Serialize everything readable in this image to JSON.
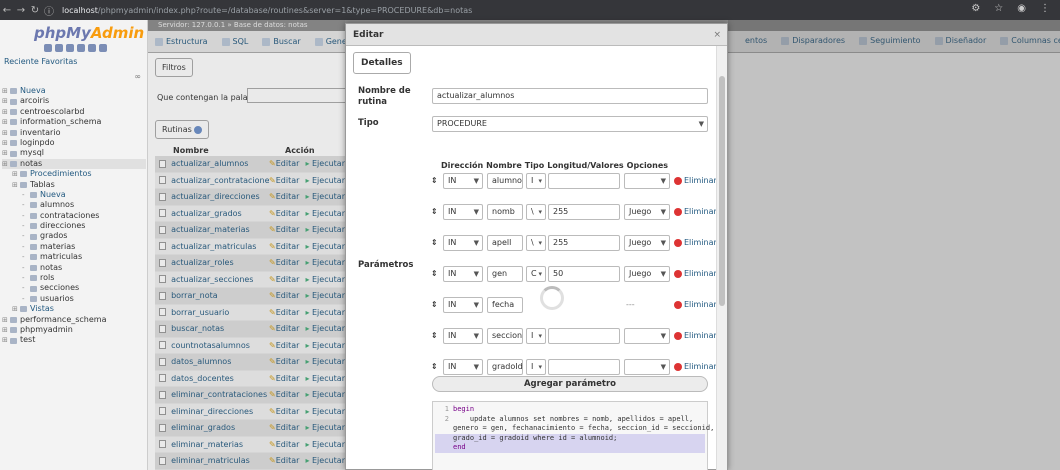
{
  "browser": {
    "url_host": "localhost",
    "url_path": "/phpmyadmin/index.php?route=/database/routines&server=1&type=PROCEDURE&db=notas"
  },
  "left_panel": {
    "logo_main": "phpMy",
    "logo_accent": "Admin",
    "recent_favorites": "Reciente  Favoritas",
    "tree": [
      {
        "label": "Nueva",
        "level": 0,
        "link": true
      },
      {
        "label": "arcoiris",
        "level": 0
      },
      {
        "label": "centroescolarbd",
        "level": 0
      },
      {
        "label": "information_schema",
        "level": 0
      },
      {
        "label": "inventario",
        "level": 0
      },
      {
        "label": "loginpdo",
        "level": 0
      },
      {
        "label": "mysql",
        "level": 0
      },
      {
        "label": "notas",
        "level": 0,
        "selected": true
      },
      {
        "label": "Procedimientos",
        "level": 1,
        "link": true
      },
      {
        "label": "Tablas",
        "level": 1
      },
      {
        "label": "Nueva",
        "level": 2,
        "link": true
      },
      {
        "label": "alumnos",
        "level": 2
      },
      {
        "label": "contrataciones",
        "level": 2
      },
      {
        "label": "direcciones",
        "level": 2
      },
      {
        "label": "grados",
        "level": 2
      },
      {
        "label": "materias",
        "level": 2
      },
      {
        "label": "matriculas",
        "level": 2
      },
      {
        "label": "notas",
        "level": 2
      },
      {
        "label": "rols",
        "level": 2
      },
      {
        "label": "secciones",
        "level": 2
      },
      {
        "label": "usuarios",
        "level": 2
      },
      {
        "label": "Vistas",
        "level": 1,
        "link": true
      },
      {
        "label": "performance_schema",
        "level": 0
      },
      {
        "label": "phpmyadmin",
        "level": 0
      },
      {
        "label": "test",
        "level": 0
      }
    ]
  },
  "topbar": {
    "breadcrumb": "Servidor: 127.0.0.1 » Base de datos: notas"
  },
  "tabs": {
    "left": [
      "Estructura",
      "SQL",
      "Buscar",
      "Gener"
    ],
    "right": [
      "entos",
      "Disparadores",
      "Seguimiento",
      "Diseñador",
      "Columnas centrales"
    ]
  },
  "filters": {
    "legend": "Filtros",
    "label": "Que contengan la palabra:"
  },
  "routines": {
    "legend": "Rutinas",
    "header_name": "Nombre",
    "header_action": "Acción",
    "edit_label": "Editar",
    "exec_label": "Ejecutar",
    "items": [
      "actualizar_alumnos",
      "actualizar_contrataciones",
      "actualizar_direcciones",
      "actualizar_grados",
      "actualizar_materias",
      "actualizar_matriculas",
      "actualizar_roles",
      "actualizar_secciones",
      "borrar_nota",
      "borrar_usuario",
      "buscar_notas",
      "countnotasalumnos",
      "datos_alumnos",
      "datos_docentes",
      "eliminar_contrataciones",
      "eliminar_direcciones",
      "eliminar_grados",
      "eliminar_materias",
      "eliminar_matriculas"
    ]
  },
  "dialog": {
    "title": "Editar",
    "close": "×",
    "details_legend": "Detalles",
    "name_label": "Nombre de rutina",
    "name_value": "actualizar_alumnos",
    "type_label": "Tipo",
    "type_value": "PROCEDURE",
    "params_label": "Parámetros",
    "param_headers": [
      "Dirección",
      "Nombre",
      "Tipo",
      "Longitud/Valores",
      "Opciones"
    ],
    "delete_label": "Eliminar",
    "params": [
      {
        "dir": "IN",
        "name": "alumnoi",
        "type": "I",
        "len": "",
        "opt": ""
      },
      {
        "dir": "IN",
        "name": "nomb",
        "type": "\\",
        "len": "255",
        "opt": "Juego"
      },
      {
        "dir": "IN",
        "name": "apell",
        "type": "\\",
        "len": "255",
        "opt": "Juego"
      },
      {
        "dir": "IN",
        "name": "gen",
        "type": "C",
        "len": "50",
        "opt": "Juego"
      },
      {
        "dir": "IN",
        "name": "fecha",
        "type": "",
        "len": "",
        "opt": "---"
      },
      {
        "dir": "IN",
        "name": "seccioni",
        "type": "I",
        "len": "",
        "opt": ""
      },
      {
        "dir": "IN",
        "name": "gradoId",
        "type": "I",
        "len": "",
        "opt": ""
      }
    ],
    "add_param": "Agregar parámetro",
    "code_lines": [
      {
        "n": "1",
        "text": "begin"
      },
      {
        "n": "2",
        "text": "    update alumnos set nombres = nomb, apellidos = apell,"
      },
      {
        "n": "",
        "text": "genero = gen, fechanacimiento = fecha, seccion_id = seccionid,"
      },
      {
        "n": "",
        "text": "grado_id = gradoid where id = alumnoid;"
      },
      {
        "n": "",
        "text": "end"
      }
    ]
  }
}
